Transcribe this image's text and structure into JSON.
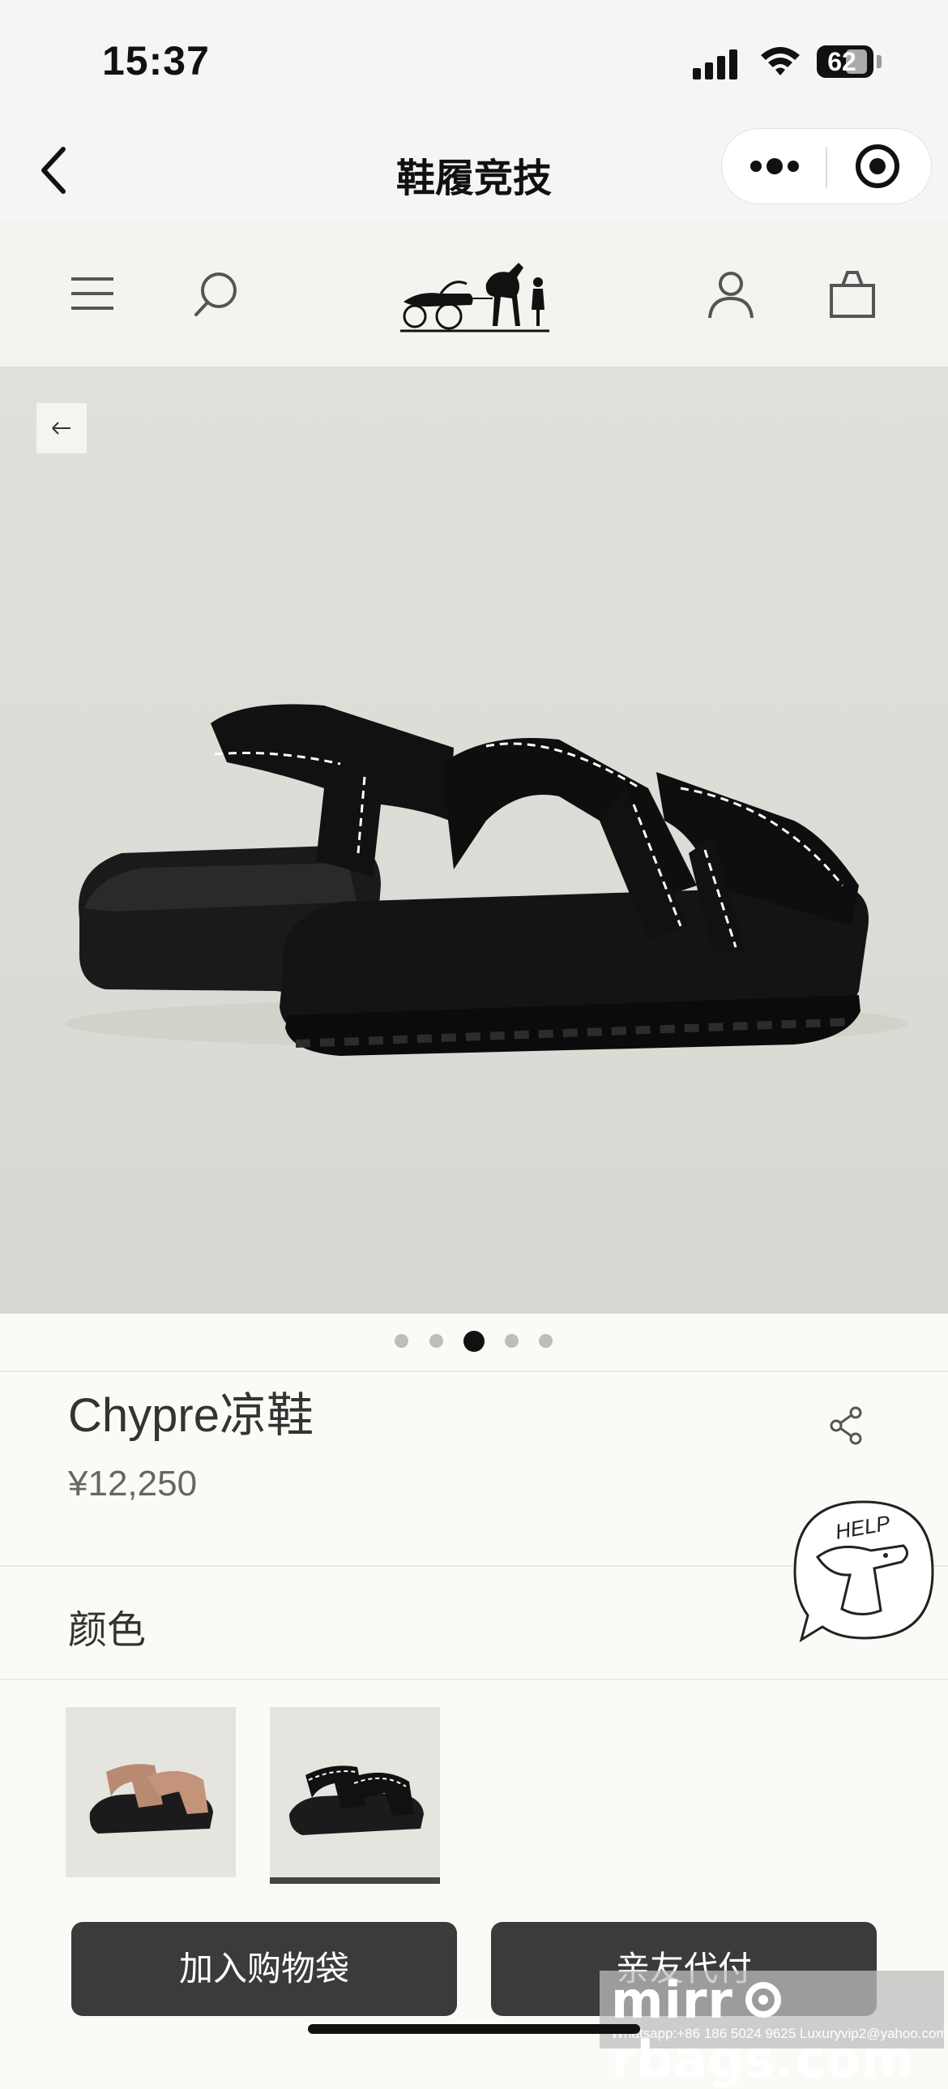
{
  "status_bar": {
    "time": "15:37",
    "battery": "62"
  },
  "nav": {
    "title": "鞋履竞技"
  },
  "product": {
    "name": "Chypre凉鞋",
    "price": "¥12,250"
  },
  "carousel": {
    "total": 5,
    "active_index": 2
  },
  "color_section": {
    "label": "颜色"
  },
  "swatches": [
    {
      "color_name": "tan"
    },
    {
      "color_name": "black",
      "selected": true
    }
  ],
  "help": {
    "label": "HELP"
  },
  "actions": {
    "add_to_bag": "加入购物袋",
    "friend_pay": "亲友代付"
  },
  "watermark": {
    "main": "mirr  rbags.com",
    "sub": "Whatsapp:+86 186 5024 9625   Luxuryvip2@yahoo.com"
  }
}
